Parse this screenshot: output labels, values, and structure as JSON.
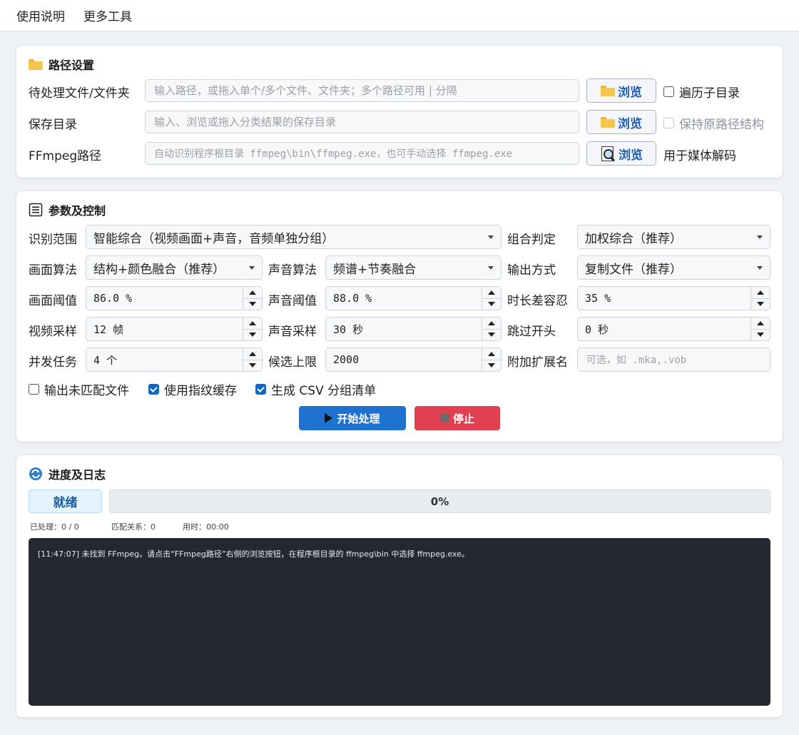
{
  "menu": {
    "items": [
      "使用说明",
      "更多工具"
    ]
  },
  "path_panel": {
    "title": "路径设置",
    "input_files": {
      "label": "待处理文件/文件夹",
      "placeholder": "输入路径，或拖入单个/多个文件、文件夹；多个路径可用 | 分隔",
      "browse": "浏览",
      "checkbox_label": "遍历子目录",
      "checked": false
    },
    "save_dir": {
      "label": "保存目录",
      "placeholder": "输入、浏览或拖入分类结果的保存目录",
      "browse": "浏览",
      "checkbox_label": "保持原路径结构",
      "checked": false,
      "disabled": true
    },
    "ffmpeg": {
      "label": "FFmpeg路径",
      "placeholder": "自动识别程序根目录 ffmpeg\\bin\\ffmpeg.exe，也可手动选择 ffmpeg.exe",
      "browse": "浏览",
      "note": "用于媒体解码"
    }
  },
  "params_panel": {
    "title": "参数及控制",
    "scope": {
      "label": "识别范围",
      "value": "智能综合（视频画面+声音，音频单独分组）"
    },
    "combine": {
      "label": "组合判定",
      "value": "加权综合（推荐）"
    },
    "image_algo": {
      "label": "画面算法",
      "value": "结构+颜色融合（推荐）"
    },
    "audio_algo": {
      "label": "声音算法",
      "value": "频谱+节奏融合"
    },
    "output_mode": {
      "label": "输出方式",
      "value": "复制文件（推荐）"
    },
    "image_threshold": {
      "label": "画面阈值",
      "value": "86.0 %"
    },
    "audio_threshold": {
      "label": "声音阈值",
      "value": "88.0 %"
    },
    "duration_tolerance": {
      "label": "时长差容忍",
      "value": "35 %"
    },
    "video_sampling": {
      "label": "视频采样",
      "value": "12 帧"
    },
    "audio_sampling": {
      "label": "声音采样",
      "value": "30 秒"
    },
    "skip_intro": {
      "label": "跳过开头",
      "value": "0 秒"
    },
    "concurrency": {
      "label": "并发任务",
      "value": "4 个"
    },
    "candidate_limit": {
      "label": "候选上限",
      "value": "2000"
    },
    "extra_ext": {
      "label": "附加扩展名",
      "placeholder": "可选，如 .mka,.vob"
    },
    "options": [
      {
        "label": "输出未匹配文件",
        "checked": false
      },
      {
        "label": "使用指纹缓存",
        "checked": true
      },
      {
        "label": "生成 CSV 分组清单",
        "checked": true
      }
    ],
    "start_button": "开始处理",
    "stop_button": "停止"
  },
  "progress_panel": {
    "title": "进度及日志",
    "status": "就绪",
    "progress_percent": 0,
    "progress_text": "0%",
    "stats": {
      "processed": "已处理：0 / 0",
      "matches": "匹配关系：0",
      "elapsed": "用时：00:00"
    },
    "log_lines": [
      "[11:47:07] 未找到 FFmpeg。请点击“FFmpeg路径”右侧的浏览按钮，在程序根目录的 ffmpeg\\bin 中选择 ffmpeg.exe。"
    ]
  },
  "colors": {
    "primary": "#1f72d0",
    "danger": "#e0404f",
    "log_bg": "#232831",
    "status_bg": "#e3f2fd"
  }
}
